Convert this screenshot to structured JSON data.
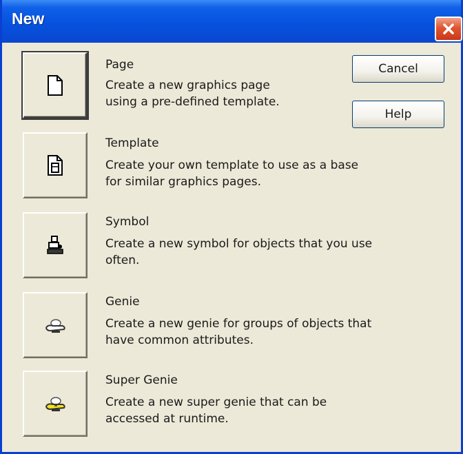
{
  "window": {
    "title": "New",
    "close_icon": "close-icon",
    "close_color": "#e0552f",
    "titlebar_color": "#0552de",
    "background_color": "#ece9d8"
  },
  "options": [
    {
      "id": "page",
      "icon": "page-icon",
      "title": "Page",
      "description": [
        "Create a new graphics page",
        "using a pre-defined template."
      ]
    },
    {
      "id": "template",
      "icon": "template-icon",
      "title": "Template",
      "description": [
        "Create your own template to use as a base",
        "for similar graphics pages."
      ]
    },
    {
      "id": "symbol",
      "icon": "symbol-icon",
      "title": "Symbol",
      "description": [
        "Create a new symbol for objects that you use",
        "often."
      ]
    },
    {
      "id": "genie",
      "icon": "genie-icon",
      "title": "Genie",
      "description": [
        "Create a new genie for groups of objects that",
        "have common attributes."
      ]
    },
    {
      "id": "super-genie",
      "icon": "super-genie-icon",
      "title": "Super Genie",
      "description": [
        "Create a new super genie that can be",
        "accessed at runtime."
      ]
    }
  ],
  "buttons": {
    "cancel_label": "Cancel",
    "help_label": "Help"
  }
}
